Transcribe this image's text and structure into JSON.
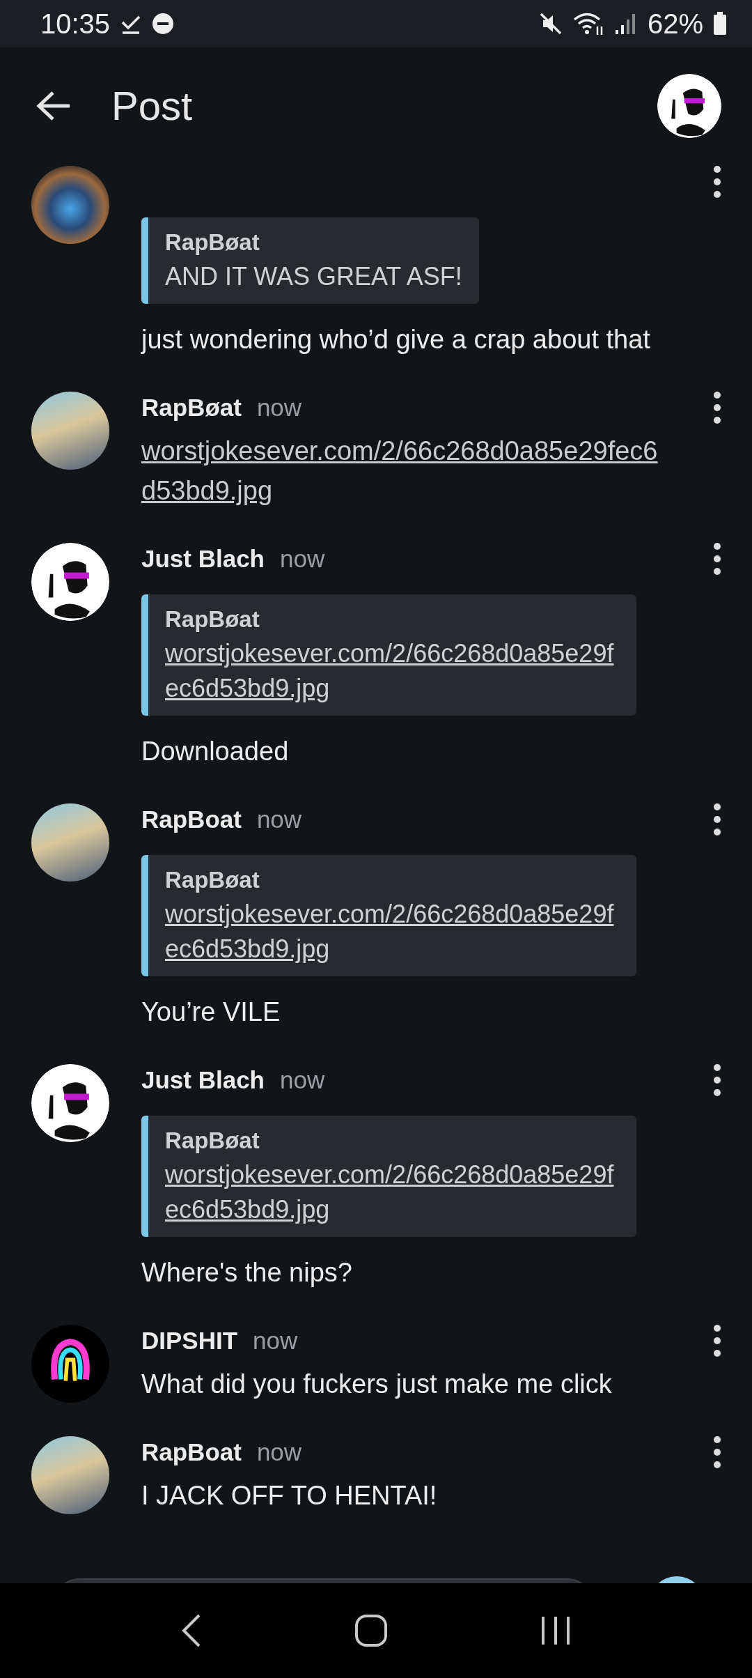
{
  "status_bar": {
    "time": "10:35",
    "battery": "62%"
  },
  "header": {
    "title": "Post"
  },
  "messages": [
    {
      "avatar": {
        "kind": "nebula"
      },
      "quote": {
        "author": "RapBøat",
        "text": "AND IT WAS GREAT ASF!",
        "is_link": false
      },
      "body": "just wondering who’d give a crap about that",
      "body_is_link": false
    },
    {
      "avatar": {
        "kind": "photo"
      },
      "author": "RapBøat",
      "time": "now",
      "body": "worstjokesever.com/2/66c268d0a85e29fec6d53bd9.jpg",
      "body_is_link": true
    },
    {
      "avatar": {
        "kind": "cartoon"
      },
      "author": "Just Blach",
      "time": "now",
      "quote": {
        "author": "RapBøat",
        "text": "worstjokesever.com/2/66c268d0a85e29fec6d53bd9.jpg",
        "is_link": true
      },
      "body": "Downloaded",
      "body_is_link": false
    },
    {
      "avatar": {
        "kind": "photo"
      },
      "author": "RapBoat",
      "time": "now",
      "quote": {
        "author": "RapBøat",
        "text": "worstjokesever.com/2/66c268d0a85e29fec6d53bd9.jpg",
        "is_link": true
      },
      "body": "You’re VILE",
      "body_is_link": false
    },
    {
      "avatar": {
        "kind": "cartoon"
      },
      "author": "Just Blach",
      "time": "now",
      "quote": {
        "author": "RapBøat",
        "text": "worstjokesever.com/2/66c268d0a85e29fec6d53bd9.jpg",
        "is_link": true
      },
      "body": "Where's the nips?",
      "body_is_link": false
    },
    {
      "avatar": {
        "kind": "rainbow"
      },
      "author": "DIPSHIT",
      "time": "now",
      "body": "What did you fuckers just make me click",
      "body_is_link": false
    },
    {
      "avatar": {
        "kind": "photo"
      },
      "author": "RapBoat",
      "time": "now",
      "body": "I JACK OFF TO HENTAI!",
      "body_is_link": false
    }
  ]
}
